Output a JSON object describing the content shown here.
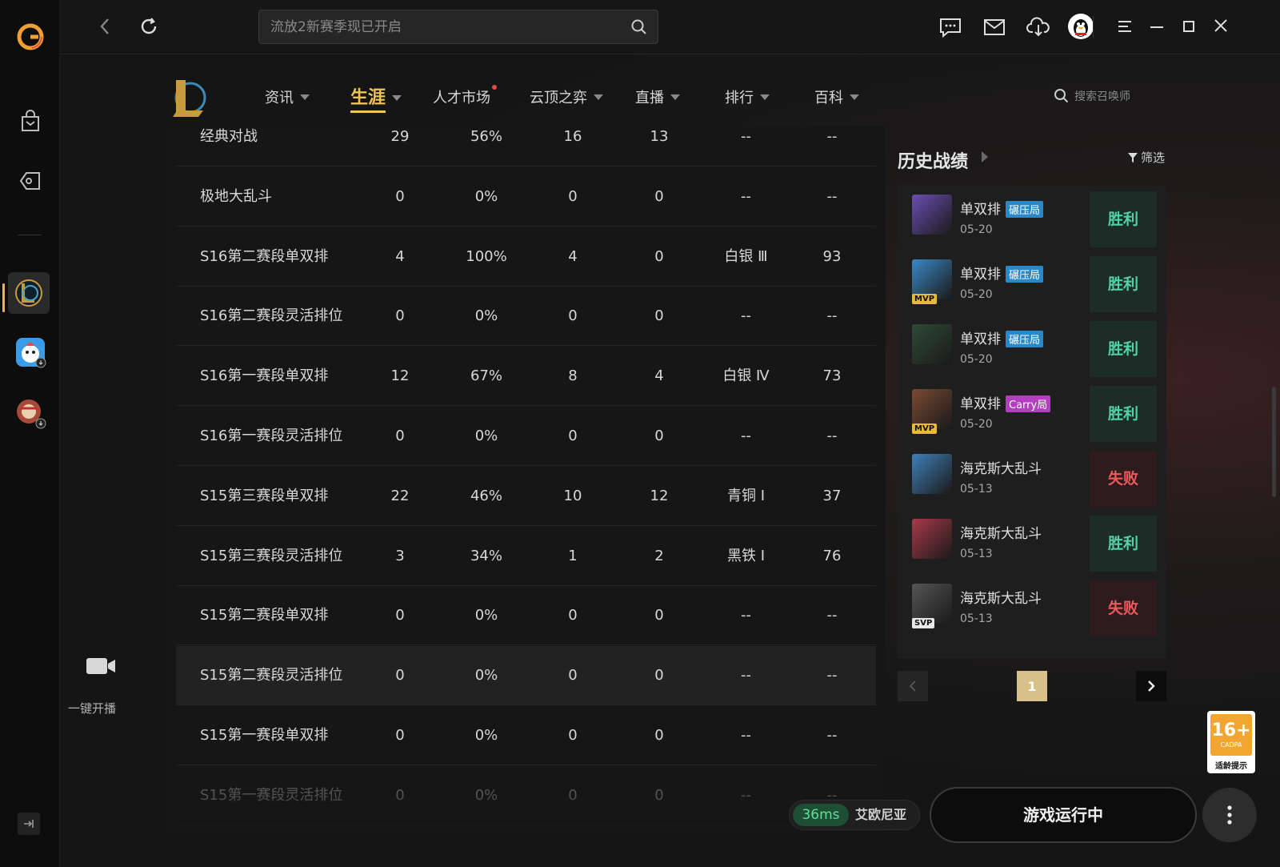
{
  "topbar": {
    "search_placeholder": "流放2新赛季现已开启"
  },
  "nav": {
    "items": [
      {
        "label": "资讯",
        "has_caret": true
      },
      {
        "label": "生涯",
        "has_caret": true,
        "active": true
      },
      {
        "label": "人才市场",
        "has_dot": true
      },
      {
        "label": "云顶之弈",
        "has_caret": true
      },
      {
        "label": "直播",
        "has_caret": true
      },
      {
        "label": "排行",
        "has_caret": true
      },
      {
        "label": "百科",
        "has_caret": true
      }
    ],
    "summoner_search_placeholder": "搜索召唤师"
  },
  "stats_table": {
    "rows": [
      [
        "经典对战",
        "29",
        "56%",
        "16",
        "13",
        "--",
        "--"
      ],
      [
        "极地大乱斗",
        "0",
        "0%",
        "0",
        "0",
        "--",
        "--"
      ],
      [
        "S16第二赛段单双排",
        "4",
        "100%",
        "4",
        "0",
        "白银 Ⅲ",
        "93"
      ],
      [
        "S16第二赛段灵活排位",
        "0",
        "0%",
        "0",
        "0",
        "--",
        "--"
      ],
      [
        "S16第一赛段单双排",
        "12",
        "67%",
        "8",
        "4",
        "白银 Ⅳ",
        "73"
      ],
      [
        "S16第一赛段灵活排位",
        "0",
        "0%",
        "0",
        "0",
        "--",
        "--"
      ],
      [
        "S15第三赛段单双排",
        "22",
        "46%",
        "10",
        "12",
        "青铜 Ⅰ",
        "37"
      ],
      [
        "S15第三赛段灵活排位",
        "3",
        "34%",
        "1",
        "2",
        "黑铁 Ⅰ",
        "76"
      ],
      [
        "S15第二赛段单双排",
        "0",
        "0%",
        "0",
        "0",
        "--",
        "--"
      ],
      [
        "S15第二赛段灵活排位",
        "0",
        "0%",
        "0",
        "0",
        "--",
        "--"
      ],
      [
        "S15第一赛段单双排",
        "0",
        "0%",
        "0",
        "0",
        "--",
        "--"
      ],
      [
        "S15第一赛段灵活排位",
        "0",
        "0%",
        "0",
        "0",
        "--",
        "--"
      ]
    ]
  },
  "history": {
    "title": "历史战绩",
    "filter_label": "筛选",
    "matches": [
      {
        "mode": "单双排",
        "tag": "碾压局",
        "tag_type": "crush",
        "date": "05-20",
        "result": "胜利",
        "win": true,
        "badge": "",
        "avatar_color": "#6a4fb0"
      },
      {
        "mode": "单双排",
        "tag": "碾压局",
        "tag_type": "crush",
        "date": "05-20",
        "result": "胜利",
        "win": true,
        "badge": "MVP",
        "avatar_color": "#3b88c4"
      },
      {
        "mode": "单双排",
        "tag": "碾压局",
        "tag_type": "crush",
        "date": "05-20",
        "result": "胜利",
        "win": true,
        "badge": "",
        "avatar_color": "#2f4a36"
      },
      {
        "mode": "单双排",
        "tag": "Carry局",
        "tag_type": "carry",
        "date": "05-20",
        "result": "胜利",
        "win": true,
        "badge": "MVP",
        "avatar_color": "#7a4a34"
      },
      {
        "mode": "海克斯大乱斗",
        "tag": "",
        "tag_type": "",
        "date": "05-13",
        "result": "失败",
        "win": false,
        "badge": "",
        "avatar_color": "#3f7fb8"
      },
      {
        "mode": "海克斯大乱斗",
        "tag": "",
        "tag_type": "",
        "date": "05-13",
        "result": "胜利",
        "win": true,
        "badge": "",
        "avatar_color": "#a83a4a"
      },
      {
        "mode": "海克斯大乱斗",
        "tag": "",
        "tag_type": "",
        "date": "05-13",
        "result": "失败",
        "win": false,
        "badge": "SVP",
        "avatar_color": "#555555"
      }
    ],
    "page": "1"
  },
  "sidebar": {
    "record_label": "一键开播"
  },
  "bottom": {
    "ping": "36ms",
    "server": "艾欧尼亚",
    "play_label": "游戏运行中"
  },
  "age_rating": {
    "number": "16+",
    "org": "CADPA",
    "tip": "适龄提示"
  }
}
